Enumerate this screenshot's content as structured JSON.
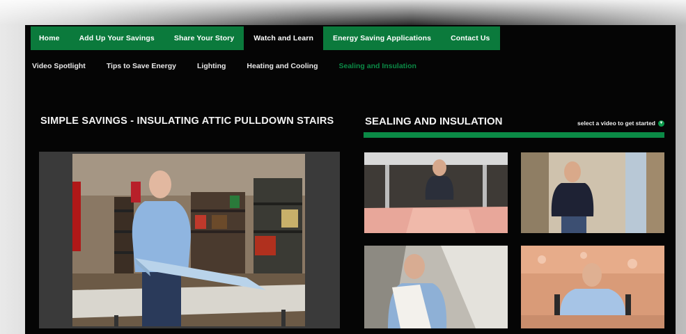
{
  "nav": {
    "top": [
      {
        "label": "Home",
        "active": false
      },
      {
        "label": "Add Up Your Savings",
        "active": false
      },
      {
        "label": "Share Your Story",
        "active": false
      },
      {
        "label": "Watch and Learn",
        "active": true
      },
      {
        "label": "Energy Saving Applications",
        "active": false
      },
      {
        "label": "Contact Us",
        "active": false
      }
    ],
    "sub": [
      {
        "label": "Video Spotlight",
        "active": false
      },
      {
        "label": "Tips to Save Energy",
        "active": false
      },
      {
        "label": "Lighting",
        "active": false
      },
      {
        "label": "Heating and Cooling",
        "active": false
      },
      {
        "label": "Sealing and Insulation",
        "active": true
      }
    ]
  },
  "main": {
    "video_title": "SIMPLE SAVINGS - INSULATING ATTIC PULLDOWN STAIRS",
    "section_title": "SEALING AND INSULATION",
    "select_hint": "select a video to get started"
  },
  "colors": {
    "brand_green": "#0b7a3c",
    "background": "#050505",
    "text": "#f2f2f2"
  },
  "icons": {
    "select_hint": "arrow-down-circle-icon"
  }
}
